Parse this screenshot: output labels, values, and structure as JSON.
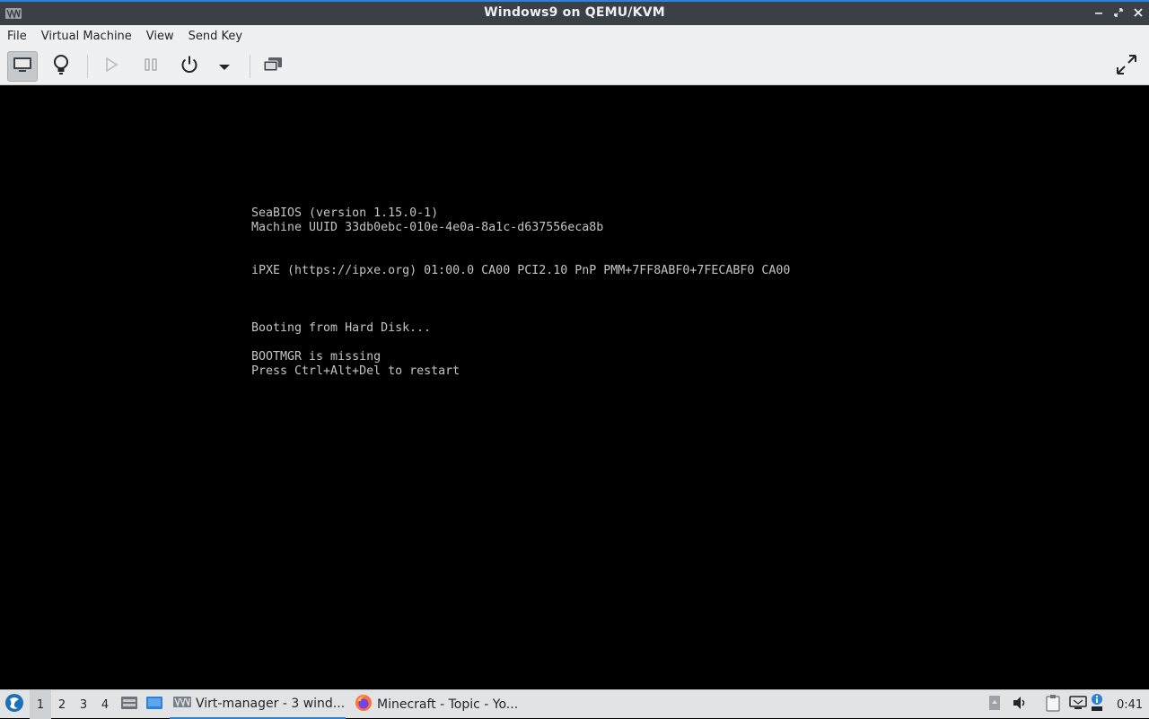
{
  "window": {
    "title": "Windows9 on QEMU/KVM",
    "controls": {
      "minimize": "minimize-icon",
      "maximize": "restore-icon",
      "close": "close-icon"
    }
  },
  "menu": [
    "File",
    "Virtual Machine",
    "View",
    "Send Key"
  ],
  "toolbar": {
    "buttons": [
      "display-icon",
      "lightbulb-icon",
      "play-icon",
      "pause-icon",
      "power-icon",
      "dropdown-arrow-icon",
      "snapshots-icon",
      "fullscreen-icon"
    ]
  },
  "console": {
    "lines": [
      "SeaBIOS (version 1.15.0-1)",
      "Machine UUID 33db0ebc-010e-4e0a-8a1c-d637556eca8b",
      "iPXE (https://ipxe.org) 01:00.0 CA00 PCI2.10 PnP PMM+7FF8ABF0+7FECABF0 CA00",
      "Booting from Hard Disk...",
      "BOOTMGR is missing",
      "Press Ctrl+Alt+Del to restart"
    ]
  },
  "taskbar": {
    "workspaces": [
      "1",
      "2",
      "3",
      "4"
    ],
    "current_workspace": "1",
    "tasks": [
      {
        "label": "Virt-manager - 3 wind...",
        "icon": "virt-manager-icon"
      },
      {
        "label": "Minecraft - Topic - Yo...",
        "icon": "firefox-icon"
      }
    ],
    "clock": "0:41"
  },
  "colors": {
    "accent": "#2a82da",
    "titlebar": "#3b4045",
    "console_text": "#c4c4c4"
  }
}
